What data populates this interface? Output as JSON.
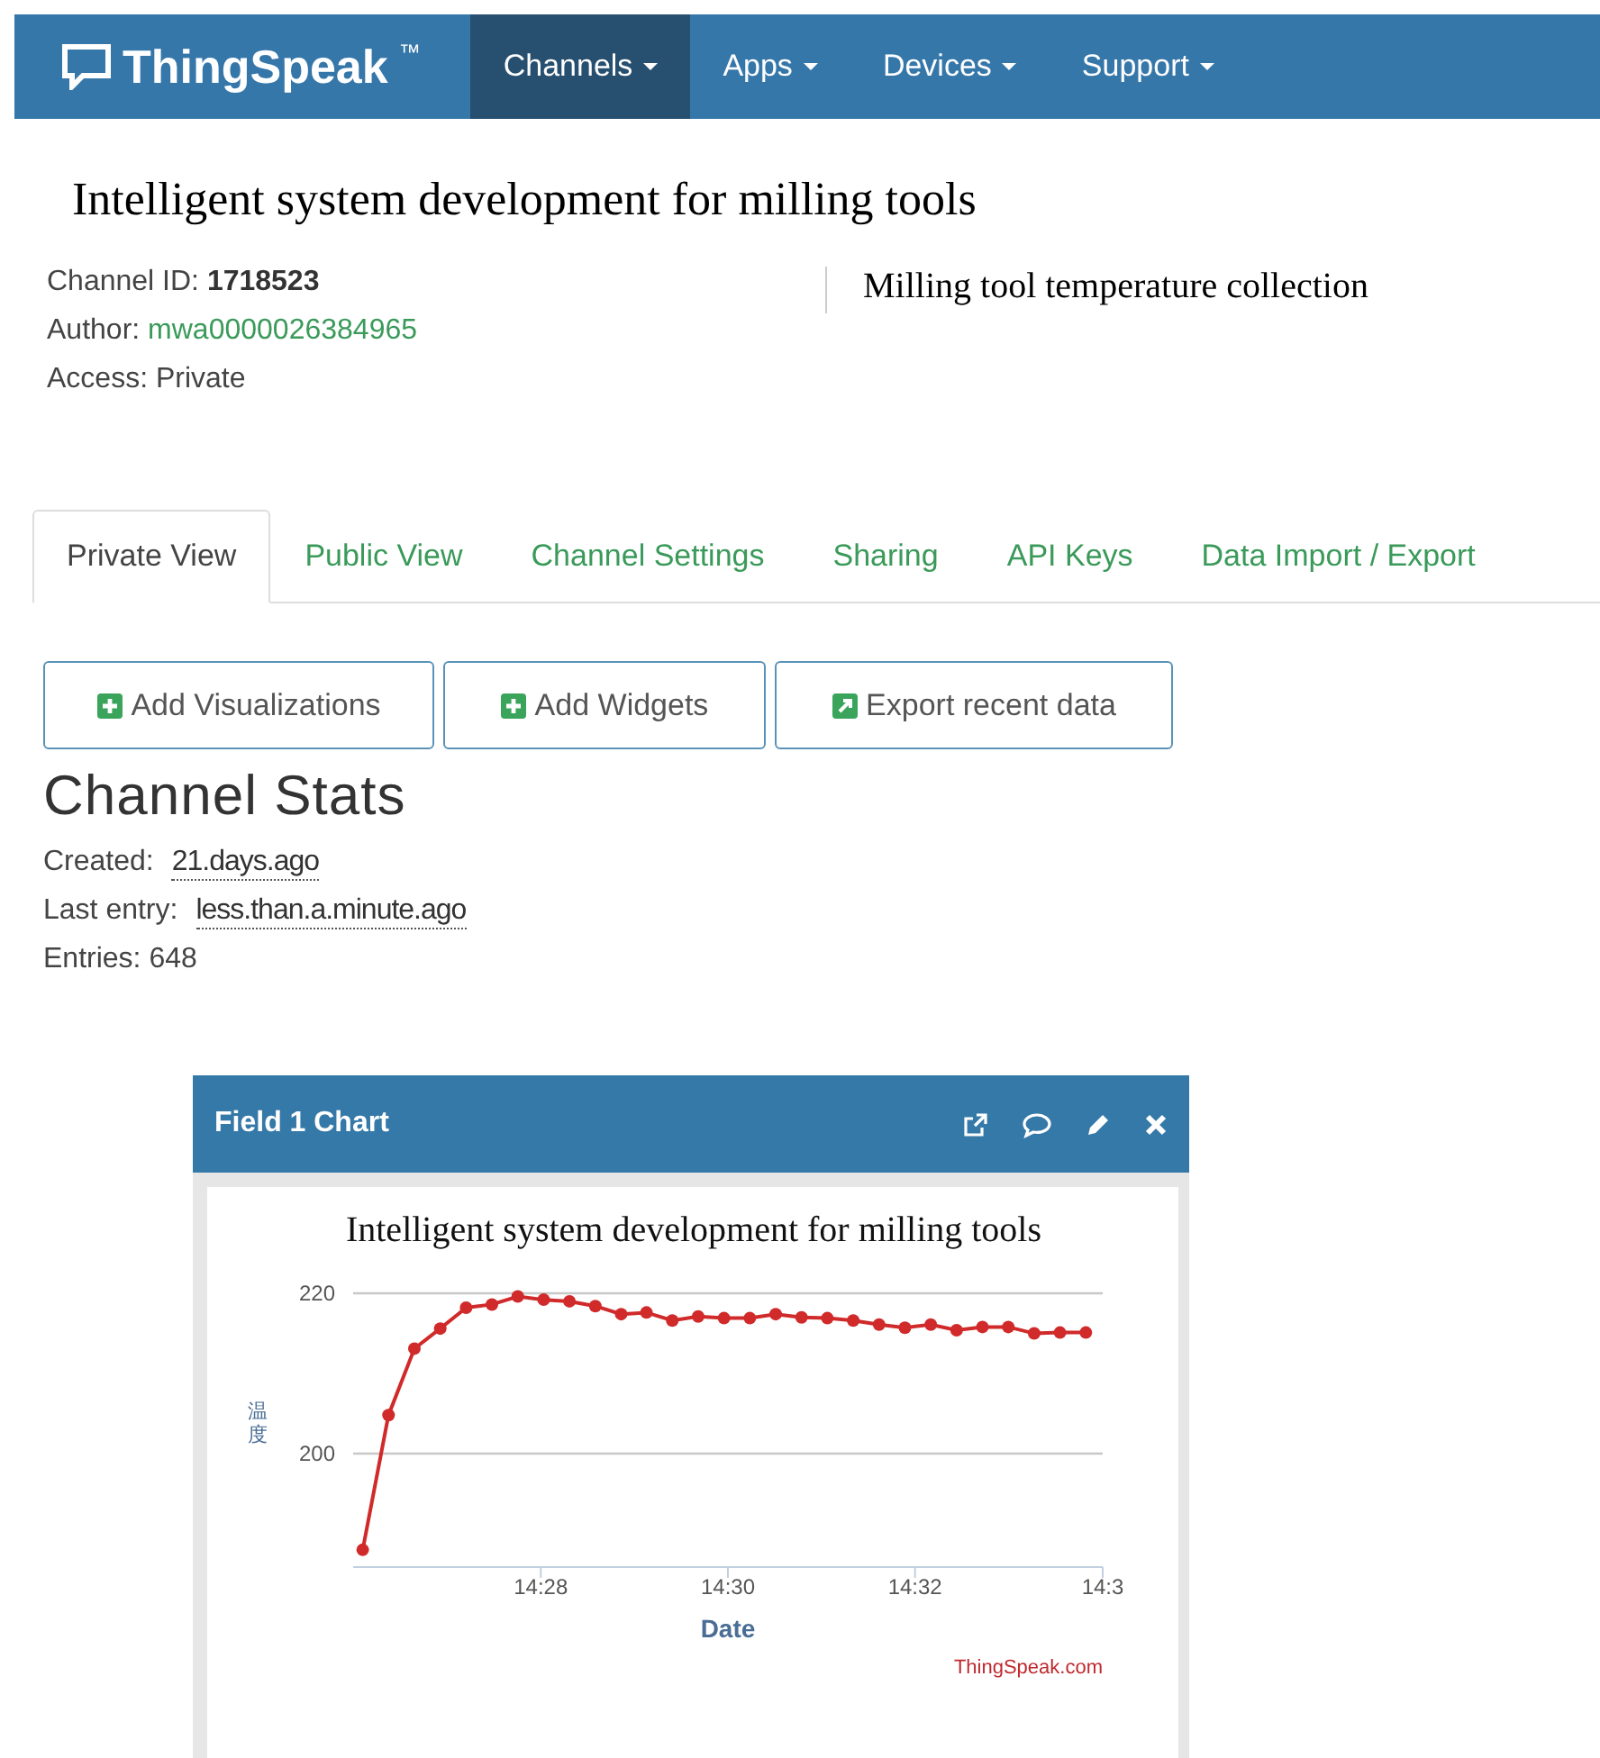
{
  "navbar": {
    "brand": "ThingSpeak",
    "brand_mark": "™",
    "menus": [
      {
        "label": "Channels",
        "selected": true
      },
      {
        "label": "Apps",
        "selected": false
      },
      {
        "label": "Devices",
        "selected": false
      },
      {
        "label": "Support",
        "selected": false
      }
    ]
  },
  "channel": {
    "title": "Intelligent system development for milling  tools",
    "id_label": "Channel ID:",
    "id": "1718523",
    "author_label": "Author:",
    "author": "mwa0000026384965",
    "access": "Access: Private",
    "description": "Milling  tool temperature  collection"
  },
  "tabs": [
    {
      "label": "Private View",
      "selected": true
    },
    {
      "label": "Public View",
      "selected": false
    },
    {
      "label": "Channel Settings",
      "selected": false
    },
    {
      "label": "Sharing",
      "selected": false
    },
    {
      "label": "API Keys",
      "selected": false
    },
    {
      "label": "Data Import / Export",
      "selected": false
    }
  ],
  "buttons": [
    {
      "label": "Add Visualizations",
      "kind": "add"
    },
    {
      "label": "Add Widgets",
      "kind": "add"
    },
    {
      "label": "Export recent data",
      "kind": "export"
    }
  ],
  "stats": {
    "heading": "Channel Stats",
    "rows": [
      {
        "label": "Created:",
        "value": "21.days.ago",
        "kind": "time"
      },
      {
        "label": "Last entry:",
        "value": "less.than.a.minute.ago",
        "kind": "time"
      },
      {
        "label": "Entries:",
        "value": "648",
        "kind": "plain"
      }
    ]
  },
  "chart_widget": {
    "title": "Field 1 Chart",
    "credit": "ThingSpeak.com",
    "chart_data": {
      "type": "line",
      "title": "Intelligent  system development for milling  tools",
      "xlabel": "Date",
      "ylabel": "温度",
      "x": [
        14.435,
        14.4396,
        14.4442,
        14.4488,
        14.4534,
        14.458,
        14.4626,
        14.4672,
        14.4718,
        14.4764,
        14.481,
        14.4855,
        14.4901,
        14.4947,
        14.4993,
        14.5039,
        14.5085,
        14.5131,
        14.5177,
        14.5223,
        14.5269,
        14.5315,
        14.5361,
        14.5407,
        14.5453,
        14.5499,
        14.5545,
        14.5591,
        14.5637
      ],
      "series": [
        {
          "marker": "circle",
          "color": "#d02a2a",
          "values": [
            188.0,
            204.8,
            213.1,
            215.6,
            218.2,
            218.6,
            219.6,
            219.2,
            219.0,
            218.4,
            217.4,
            217.6,
            216.6,
            217.1,
            216.9,
            216.9,
            217.4,
            217.0,
            216.9,
            216.6,
            216.1,
            215.7,
            216.1,
            215.4,
            215.8,
            215.8,
            215.0,
            215.1,
            215.1
          ]
        }
      ],
      "xlim": [
        14.4333,
        14.5667
      ],
      "ylim": [
        186.3,
        220
      ],
      "xticks": [
        {
          "value": 14.4667,
          "label": "14:28"
        },
        {
          "value": 14.5,
          "label": "14:30"
        },
        {
          "value": 14.5333,
          "label": "14:32"
        },
        {
          "value": 14.5667,
          "label": "14:3"
        }
      ],
      "yticks": [
        200,
        220
      ]
    }
  }
}
